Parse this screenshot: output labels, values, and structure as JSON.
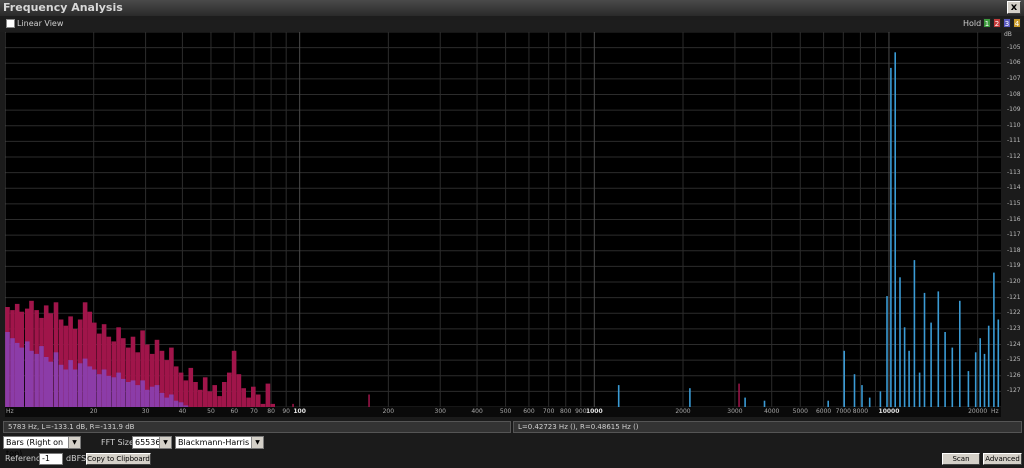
{
  "window": {
    "title": "Frequency Analysis",
    "close_label": "x"
  },
  "toolbar": {
    "linear_view_label": "Linear View",
    "hold_label": "Hold",
    "hold_buttons": [
      "1",
      "2",
      "3",
      "4"
    ]
  },
  "colors": {
    "left_channel": "#a0154a",
    "right_channel": "#8c3ca8",
    "peaks": "#3a9bd5",
    "background": "#000000",
    "grid": "#2c2c2c"
  },
  "chart_data": {
    "type": "bar",
    "x_scale": "log",
    "x_unit": "Hz",
    "y_unit": "dB",
    "xlim": [
      10,
      24000
    ],
    "ylim": [
      -128,
      -104
    ],
    "x_ticks": [
      {
        "v": 20,
        "label": "20"
      },
      {
        "v": 30,
        "label": "30"
      },
      {
        "v": 40,
        "label": "40"
      },
      {
        "v": 50,
        "label": "50"
      },
      {
        "v": 60,
        "label": "60"
      },
      {
        "v": 70,
        "label": "70"
      },
      {
        "v": 80,
        "label": "80"
      },
      {
        "v": 90,
        "label": "90"
      },
      {
        "v": 100,
        "label": "100"
      },
      {
        "v": 200,
        "label": "200"
      },
      {
        "v": 300,
        "label": "300"
      },
      {
        "v": 400,
        "label": "400"
      },
      {
        "v": 500,
        "label": "500"
      },
      {
        "v": 600,
        "label": "600"
      },
      {
        "v": 700,
        "label": "700"
      },
      {
        "v": 800,
        "label": "800"
      },
      {
        "v": 900,
        "label": "900"
      },
      {
        "v": 1000,
        "label": "1000"
      },
      {
        "v": 2000,
        "label": "2000"
      },
      {
        "v": 3000,
        "label": "3000"
      },
      {
        "v": 4000,
        "label": "4000"
      },
      {
        "v": 5000,
        "label": "5000"
      },
      {
        "v": 6000,
        "label": "6000"
      },
      {
        "v": 7000,
        "label": "7000"
      },
      {
        "v": 8000,
        "label": "8000"
      },
      {
        "v": 10000,
        "label": "10000"
      },
      {
        "v": 20000,
        "label": "20000"
      }
    ],
    "y_ticks": [
      "-105",
      "-106",
      "-107",
      "-108",
      "-109",
      "-110",
      "-111",
      "-112",
      "-113",
      "-114",
      "-115",
      "-116",
      "-117",
      "-118",
      "-119",
      "-120",
      "-121",
      "-122",
      "-123",
      "-124",
      "-125",
      "-126",
      "-127"
    ],
    "series": [
      {
        "name": "L",
        "values": [
          [
            10.2,
            -121.6
          ],
          [
            10.6,
            -121.8
          ],
          [
            11,
            -121.4
          ],
          [
            11.4,
            -121.9
          ],
          [
            11.9,
            -121.7
          ],
          [
            12.3,
            -121.2
          ],
          [
            12.8,
            -121.8
          ],
          [
            13.3,
            -122.3
          ],
          [
            13.8,
            -121.5
          ],
          [
            14.3,
            -122
          ],
          [
            14.9,
            -121.3
          ],
          [
            15.5,
            -122.4
          ],
          [
            16.1,
            -122.8
          ],
          [
            16.7,
            -122.2
          ],
          [
            17.3,
            -123
          ],
          [
            18,
            -122.4
          ],
          [
            18.7,
            -121.3
          ],
          [
            19.4,
            -121.9
          ],
          [
            20.1,
            -122.6
          ],
          [
            20.9,
            -123.3
          ],
          [
            21.7,
            -122.7
          ],
          [
            22.5,
            -123.5
          ],
          [
            23.4,
            -123.8
          ],
          [
            24.3,
            -122.9
          ],
          [
            25.2,
            -123.6
          ],
          [
            26.2,
            -124.2
          ],
          [
            27.2,
            -123.5
          ],
          [
            28.2,
            -124.5
          ],
          [
            29.3,
            -123.1
          ],
          [
            30.4,
            -124
          ],
          [
            31.6,
            -124.6
          ],
          [
            32.8,
            -123.7
          ],
          [
            34.1,
            -124.4
          ],
          [
            35.4,
            -125
          ],
          [
            36.7,
            -124.2
          ],
          [
            38.1,
            -125.4
          ],
          [
            39.6,
            -125.8
          ],
          [
            41.1,
            -126.3
          ],
          [
            42.7,
            -125.5
          ],
          [
            44.3,
            -126.4
          ],
          [
            46,
            -126.9
          ],
          [
            47.8,
            -126.1
          ],
          [
            49.6,
            -127
          ],
          [
            51.5,
            -126.6
          ],
          [
            53.5,
            -127.3
          ],
          [
            55.5,
            -126.4
          ],
          [
            57.7,
            -125.8
          ],
          [
            59.9,
            -124.4
          ],
          [
            62.2,
            -125.9
          ],
          [
            64.6,
            -126.8
          ],
          [
            67.1,
            -127.4
          ],
          [
            69.6,
            -126.7
          ],
          [
            72.3,
            -127.2
          ],
          [
            75.1,
            -127.8
          ],
          [
            78,
            -126.5
          ],
          [
            81,
            -127.8
          ],
          [
            84,
            -128
          ],
          [
            95,
            -127.8
          ],
          [
            172,
            -127.2
          ],
          [
            3100,
            -126.5
          ]
        ]
      },
      {
        "name": "R",
        "values": [
          [
            10.2,
            -123.2
          ],
          [
            10.6,
            -123.6
          ],
          [
            11,
            -123.9
          ],
          [
            11.4,
            -124.2
          ],
          [
            11.9,
            -123.8
          ],
          [
            12.3,
            -124.4
          ],
          [
            12.8,
            -124.6
          ],
          [
            13.3,
            -124.1
          ],
          [
            13.8,
            -124.8
          ],
          [
            14.3,
            -125.1
          ],
          [
            14.9,
            -124.5
          ],
          [
            15.5,
            -125.3
          ],
          [
            16.1,
            -125.6
          ],
          [
            16.7,
            -125
          ],
          [
            17.3,
            -125.6
          ],
          [
            18,
            -125.2
          ],
          [
            18.7,
            -124.9
          ],
          [
            19.4,
            -125.4
          ],
          [
            20.1,
            -125.6
          ],
          [
            20.9,
            -125.9
          ],
          [
            21.7,
            -125.6
          ],
          [
            22.5,
            -126
          ],
          [
            23.4,
            -126.1
          ],
          [
            24.3,
            -125.8
          ],
          [
            25.2,
            -126.2
          ],
          [
            26.2,
            -126.4
          ],
          [
            27.2,
            -126.3
          ],
          [
            28.2,
            -126.6
          ],
          [
            29.3,
            -126.3
          ],
          [
            30.4,
            -126.9
          ],
          [
            31.6,
            -126.7
          ],
          [
            32.8,
            -126.6
          ],
          [
            34.1,
            -127.1
          ],
          [
            35.4,
            -127.4
          ],
          [
            36.7,
            -127.2
          ],
          [
            38.1,
            -127.6
          ],
          [
            39.6,
            -127.7
          ],
          [
            41.1,
            -127.9
          ]
        ]
      },
      {
        "name": "peaks",
        "values": [
          [
            1210,
            -126.6
          ],
          [
            2110,
            -126.8
          ],
          [
            3250,
            -127.4
          ],
          [
            3780,
            -127.6
          ],
          [
            6220,
            -127.6
          ],
          [
            7050,
            -124.4
          ],
          [
            7640,
            -125.9
          ],
          [
            8100,
            -126.6
          ],
          [
            8600,
            -127.4
          ],
          [
            9350,
            -127
          ],
          [
            9850,
            -120.9
          ],
          [
            10150,
            -106.3
          ],
          [
            10500,
            -105.3
          ],
          [
            10900,
            -119.7
          ],
          [
            11300,
            -122.9
          ],
          [
            11700,
            -124.4
          ],
          [
            12200,
            -118.6
          ],
          [
            12700,
            -125.8
          ],
          [
            13200,
            -120.7
          ],
          [
            13900,
            -122.6
          ],
          [
            14700,
            -120.6
          ],
          [
            15500,
            -123.2
          ],
          [
            16400,
            -124.2
          ],
          [
            17400,
            -121.2
          ],
          [
            18600,
            -125.7
          ],
          [
            19700,
            -124.5
          ],
          [
            20400,
            -123.6
          ],
          [
            21100,
            -124.6
          ],
          [
            21800,
            -122.8
          ],
          [
            22700,
            -119.4
          ],
          [
            23500,
            -122.4
          ]
        ]
      }
    ]
  },
  "status": {
    "left": "5783 Hz, L=-133.1 dB, R=-131.9 dB",
    "right": "L=0.42723 Hz (), R=0.48615 Hz ()"
  },
  "controls": {
    "display_mode": "Bars (Right on top)",
    "fft_size_label": "FFT Size",
    "fft_size": "65536",
    "window_function": "Blackmann-Harris",
    "reference_label": "Reference",
    "reference_value": "-1",
    "reference_unit": "dBFS",
    "copy_button": "Copy to Clipboard",
    "scan_button": "Scan",
    "advanced_button": "Advanced"
  },
  "hz_label": "Hz",
  "db_label": "dB"
}
